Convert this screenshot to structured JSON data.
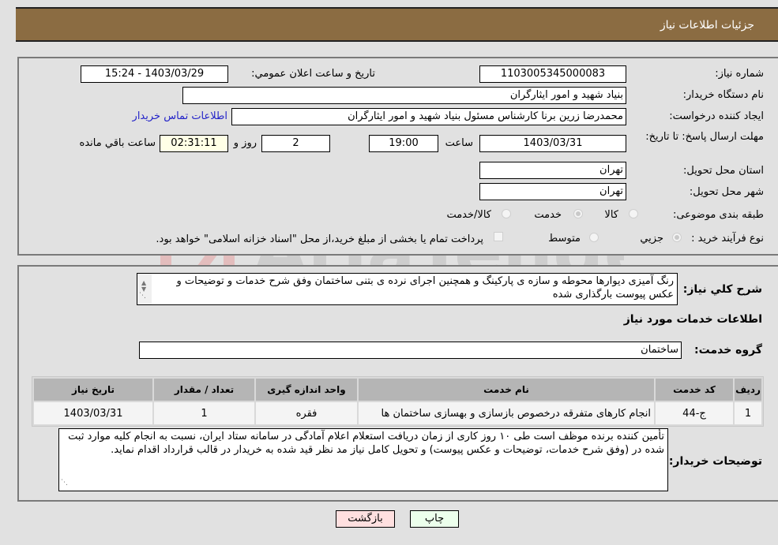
{
  "header": {
    "title": "جزئیات اطلاعات نیاز"
  },
  "form": {
    "need_number_label": "شماره نیاز:",
    "need_number": "1103005345000083",
    "announce_label": "تاریخ و ساعت اعلان عمومي:",
    "announce_value": "1403/03/29 - 15:24",
    "buyer_org_label": "نام دستگاه خریدار:",
    "buyer_org": "بنیاد شهید و امور ایثارگران",
    "creator_label": "ایجاد کننده درخواست:",
    "creator": "محمدرضا زرین برنا کارشناس مسئول  بنیاد شهید و امور ایثارگران",
    "contact_link": "اطلاعات تماس خریدار",
    "deadline_label": "مهلت ارسال پاسخ: تا تاریخ:",
    "deadline_date": "1403/03/31",
    "time_label": "ساعت",
    "deadline_time": "19:00",
    "days_value": "2",
    "days_label": "روز و",
    "remaining_time": "02:31:11",
    "remaining_label": "ساعت باقي مانده",
    "province_label": "استان محل تحویل:",
    "province": "تهران",
    "city_label": "شهر محل تحویل:",
    "city": "تهران",
    "category_label": "طبقه بندی موضوعی:",
    "category_options": [
      "کالا",
      "خدمت",
      "کالا/خدمت"
    ],
    "category_selected": "خدمت",
    "purchase_type_label": "نوع فرآیند خرید :",
    "purchase_options": [
      "جزيي",
      "متوسط"
    ],
    "purchase_selected": "جزيي",
    "treasury_note": "پرداخت تمام یا بخشی از مبلغ خرید،از محل \"اسناد خزانه اسلامی\" خواهد بود."
  },
  "details": {
    "summary_label": "شرح کلي نیاز:",
    "summary": "رنگ آمیزی دیوارها محوطه و سازه ی پارکینگ و همچنین اجرای نرده ی بتنی ساختمان وفق شرح خدمات و توضیحات و عکس پیوست بارگذاری شده",
    "services_heading": "اطلاعات خدمات مورد نیاز",
    "service_group_label": "گروه خدمت:",
    "service_group": "ساختمان",
    "table": {
      "headers": [
        "ردیف",
        "کد خدمت",
        "نام خدمت",
        "واحد اندازه گیری",
        "تعداد / مقدار",
        "تاریخ نیاز"
      ],
      "rows": [
        [
          "1",
          "ج-44",
          "انجام کارهای متفرقه درخصوص بازسازی و بهسازی ساختمان ها",
          "فقره",
          "1",
          "1403/03/31"
        ]
      ]
    },
    "buyer_notes_label": "توضیحات خریدار:",
    "buyer_notes": "تأمین کننده برنده موظف است طی ۱۰ روز کاری از زمان دریافت استعلام اعلام آمادگی در سامانه ستاد ایران، نسبت به انجام کلیه موارد ثبت شده در (وفق شرح خدمات، توضیحات و عکس پیوست) و تحویل کامل نیاز مد نظر قید شده به خریدار در قالب قرارداد  اقدام نماید."
  },
  "buttons": {
    "print": "چاپ",
    "back": "بازگشت"
  },
  "colors": {
    "header_bg": "#8b6c42",
    "back_btn_bg": "#ffe0e0",
    "print_btn_bg": "#ecffec",
    "remaining_bg": "#ffffe6",
    "link": "#2323c8"
  }
}
